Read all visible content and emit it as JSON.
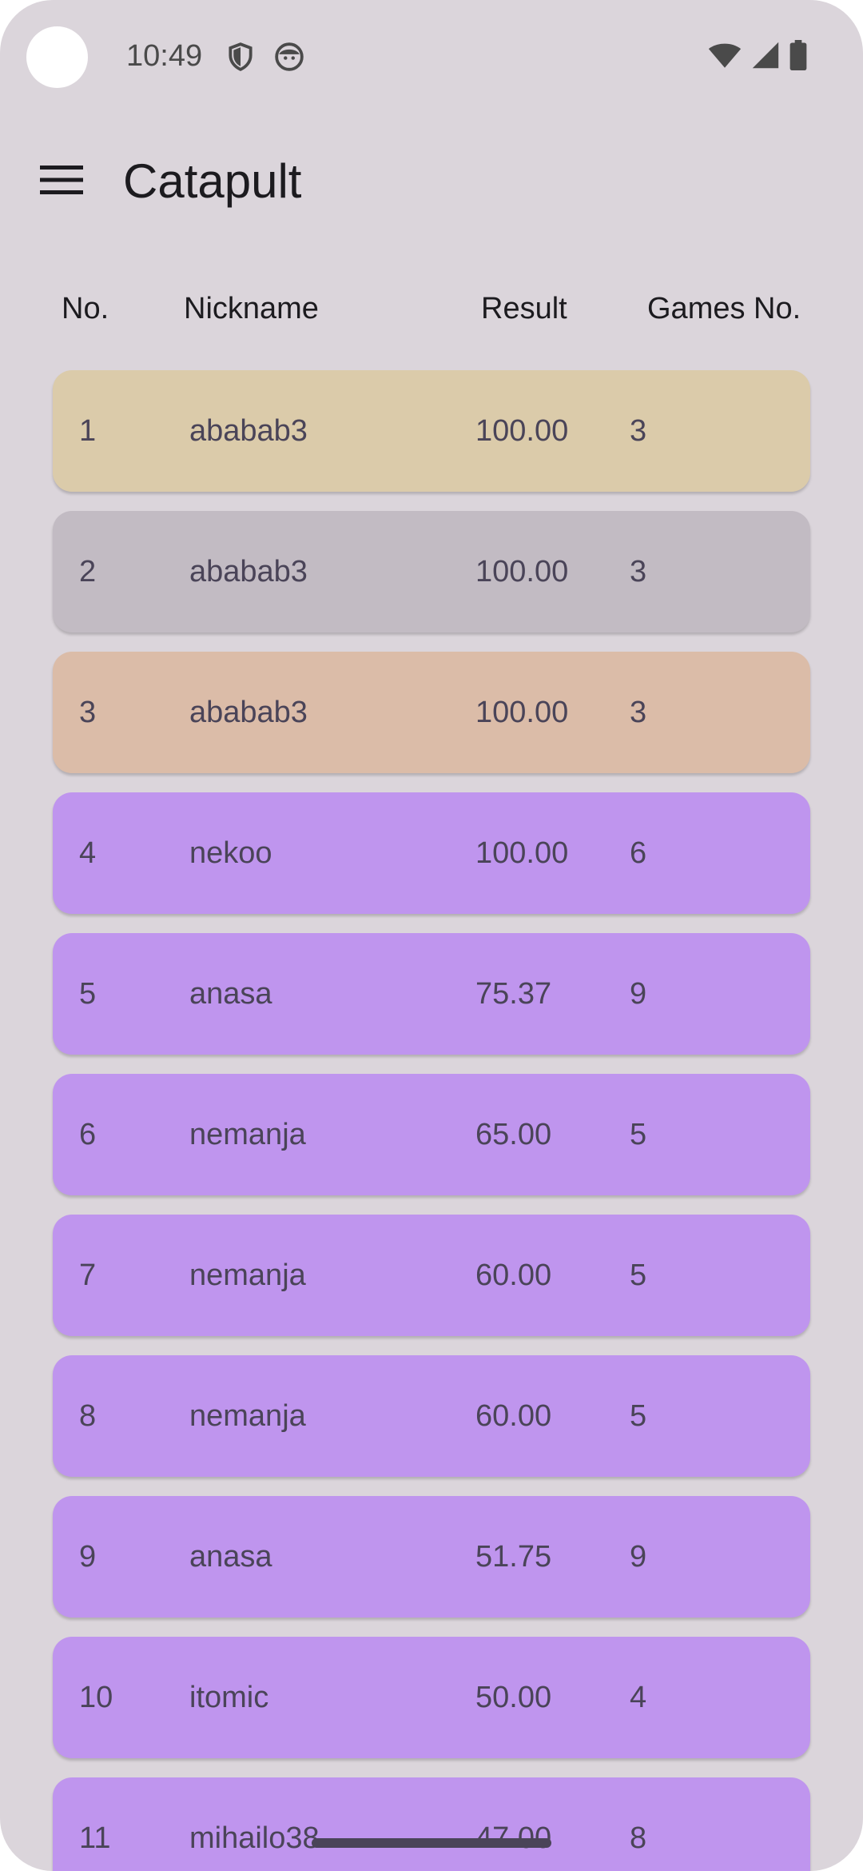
{
  "status_bar": {
    "time": "10:49",
    "icons": [
      "shield-icon",
      "face-icon"
    ],
    "right_icons": [
      "wifi-icon",
      "signal-icon",
      "battery-icon"
    ]
  },
  "app_bar": {
    "menu_icon": "hamburger-menu-icon",
    "title": "Catapult"
  },
  "table": {
    "headers": {
      "no": "No.",
      "nickname": "Nickname",
      "result": "Result",
      "games": "Games No."
    },
    "rows": [
      {
        "no": "1",
        "nickname": "ababab3",
        "result": "100.00",
        "games": "3",
        "color": "#dbcbaa"
      },
      {
        "no": "2",
        "nickname": "ababab3",
        "result": "100.00",
        "games": "3",
        "color": "#c2bbc3"
      },
      {
        "no": "3",
        "nickname": "ababab3",
        "result": "100.00",
        "games": "3",
        "color": "#dbbca8"
      },
      {
        "no": "4",
        "nickname": "nekoo",
        "result": "100.00",
        "games": "6",
        "color": "#bf95ee"
      },
      {
        "no": "5",
        "nickname": "anasa",
        "result": "75.37",
        "games": "9",
        "color": "#bf95ee"
      },
      {
        "no": "6",
        "nickname": "nemanja",
        "result": "65.00",
        "games": "5",
        "color": "#bf95ee"
      },
      {
        "no": "7",
        "nickname": "nemanja",
        "result": "60.00",
        "games": "5",
        "color": "#bf95ee"
      },
      {
        "no": "8",
        "nickname": "nemanja",
        "result": "60.00",
        "games": "5",
        "color": "#bf95ee"
      },
      {
        "no": "9",
        "nickname": "anasa",
        "result": "51.75",
        "games": "9",
        "color": "#bf95ee"
      },
      {
        "no": "10",
        "nickname": "itomic",
        "result": "50.00",
        "games": "4",
        "color": "#bf95ee"
      },
      {
        "no": "11",
        "nickname": "mihailo38",
        "result": "47.00",
        "games": "8",
        "color": "#bf95ee"
      }
    ]
  },
  "colors": {
    "background": "#dbd5db",
    "gold": "#dbcbaa",
    "silver": "#c2bbc3",
    "bronze": "#dbbca8",
    "purple": "#bf95ee"
  }
}
